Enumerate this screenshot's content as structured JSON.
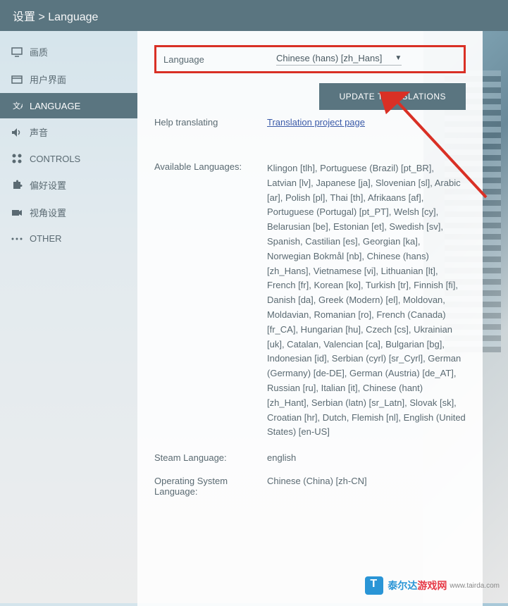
{
  "header": {
    "breadcrumb_root": "设置",
    "breadcrumb_sep": ">",
    "breadcrumb_current": "Language"
  },
  "sidebar": {
    "items": [
      {
        "label": "画质"
      },
      {
        "label": "用户界面"
      },
      {
        "label": "LANGUAGE"
      },
      {
        "label": "声音"
      },
      {
        "label": "CONTROLS"
      },
      {
        "label": "偏好设置"
      },
      {
        "label": "视角设置"
      },
      {
        "label": "OTHER"
      }
    ]
  },
  "content": {
    "language_label": "Language",
    "language_value": "Chinese (hans) [zh_Hans]",
    "update_button": "UPDATE TRANSLATIONS",
    "help_label": "Help translating",
    "help_link": "Translation project page",
    "available_label": "Available Languages:",
    "available_value": "Klingon [tlh], Portuguese (Brazil) [pt_BR], Latvian [lv], Japanese [ja], Slovenian [sl], Arabic [ar], Polish [pl], Thai [th], Afrikaans [af], Portuguese (Portugal) [pt_PT], Welsh [cy], Belarusian [be], Estonian [et], Swedish [sv], Spanish, Castilian [es], Georgian [ka], Norwegian Bokmål [nb], Chinese (hans) [zh_Hans], Vietnamese [vi], Lithuanian [lt], French [fr], Korean [ko], Turkish [tr], Finnish [fi], Danish [da], Greek (Modern) [el], Moldovan, Moldavian, Romanian [ro], French (Canada) [fr_CA], Hungarian [hu], Czech [cs], Ukrainian [uk], Catalan, Valencian [ca], Bulgarian [bg], Indonesian [id], Serbian (cyrl) [sr_Cyrl], German (Germany) [de-DE], German (Austria) [de_AT], Russian [ru], Italian [it], Chinese (hant) [zh_Hant], Serbian (latn) [sr_Latn], Slovak [sk], Croatian [hr], Dutch, Flemish [nl], English (United States) [en-US]",
    "steam_label": "Steam Language:",
    "steam_value": "english",
    "os_label": "Operating System Language:",
    "os_value": "Chinese (China) [zh-CN]"
  },
  "watermark": {
    "text1": "泰尔达",
    "text2": "游戏网",
    "url": "www.tairda.com"
  }
}
